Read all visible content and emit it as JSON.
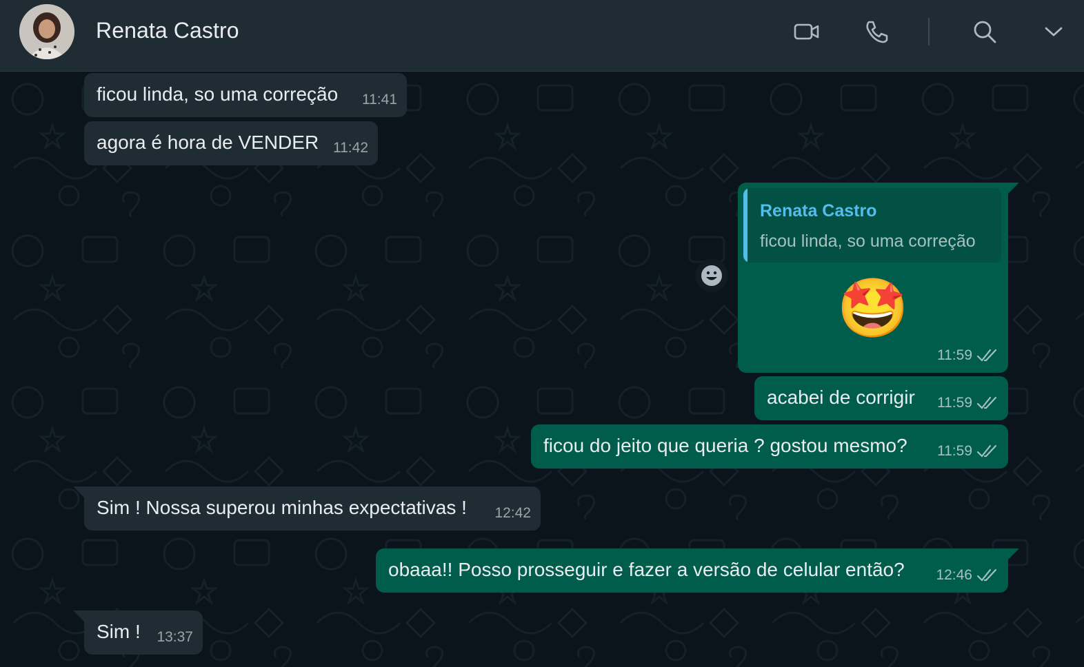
{
  "header": {
    "contact_name": "Renata Castro",
    "icons": [
      "video-call-icon",
      "voice-call-icon",
      "search-icon",
      "chevron-down-icon"
    ]
  },
  "messages": [
    {
      "direction": "in",
      "text": "ficou linda, so uma correção",
      "time": "11:41"
    },
    {
      "direction": "in",
      "text": "agora é hora de VENDER",
      "time": "11:42"
    },
    {
      "direction": "out",
      "quote_name": "Renata Castro",
      "quote_text": "ficou linda, so uma correção",
      "emoji": "🤩",
      "time": "11:59",
      "status": "read"
    },
    {
      "direction": "out",
      "text": "acabei de corrigir",
      "time": "11:59",
      "status": "read"
    },
    {
      "direction": "out",
      "text": "ficou do jeito que queria ? gostou mesmo?",
      "time": "11:59",
      "status": "read"
    },
    {
      "direction": "in",
      "text": "Sim ! Nossa superou minhas expectativas !",
      "time": "12:42"
    },
    {
      "direction": "out",
      "text": "obaaa!! Posso prosseguir e fazer a versão de celular então?",
      "time": "12:46",
      "status": "read"
    },
    {
      "direction": "in",
      "text": "Sim !",
      "time": "13:37"
    }
  ],
  "colors": {
    "header_bg": "#202c33",
    "chat_bg": "#0b141a",
    "incoming_bubble": "#202c33",
    "outgoing_bubble": "#005c4b",
    "quote_accent": "#53bdeb"
  }
}
